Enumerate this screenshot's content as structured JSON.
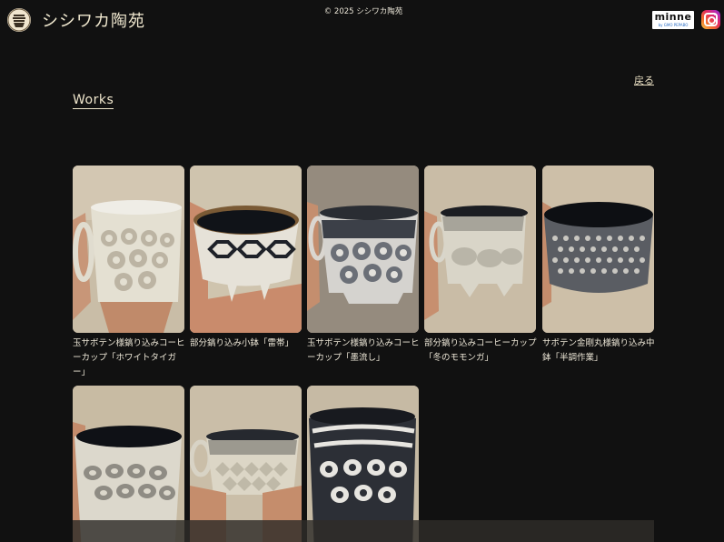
{
  "header": {
    "site_title": "シシワカ陶苑",
    "minne_label": "minne",
    "minne_sub": "by GMO PEPABO"
  },
  "nav": {
    "back_label": "戻る"
  },
  "section": {
    "title": "Works"
  },
  "works": [
    {
      "title": "玉サボテン様鎬り込みコーヒーカップ「ホワイトタイガー」"
    },
    {
      "title": "部分鎬り込み小鉢「雷帯」"
    },
    {
      "title": "玉サボテン様鎬り込みコーヒーカップ「墨流し」"
    },
    {
      "title": "部分鎬り込みコーヒーカップ「冬のモモンガ」"
    },
    {
      "title": "サボテン金剛丸様鎬り込み中鉢「半調作業」"
    },
    {
      "title": ""
    },
    {
      "title": ""
    },
    {
      "title": ""
    }
  ],
  "footer": {
    "copyright": "© 2025 シシワカ陶苑"
  },
  "colors": {
    "background": "#111111",
    "accent_text": "#efe6cc"
  },
  "icons": [
    "logo-emblem-icon",
    "minne-logo-icon",
    "instagram-icon"
  ]
}
